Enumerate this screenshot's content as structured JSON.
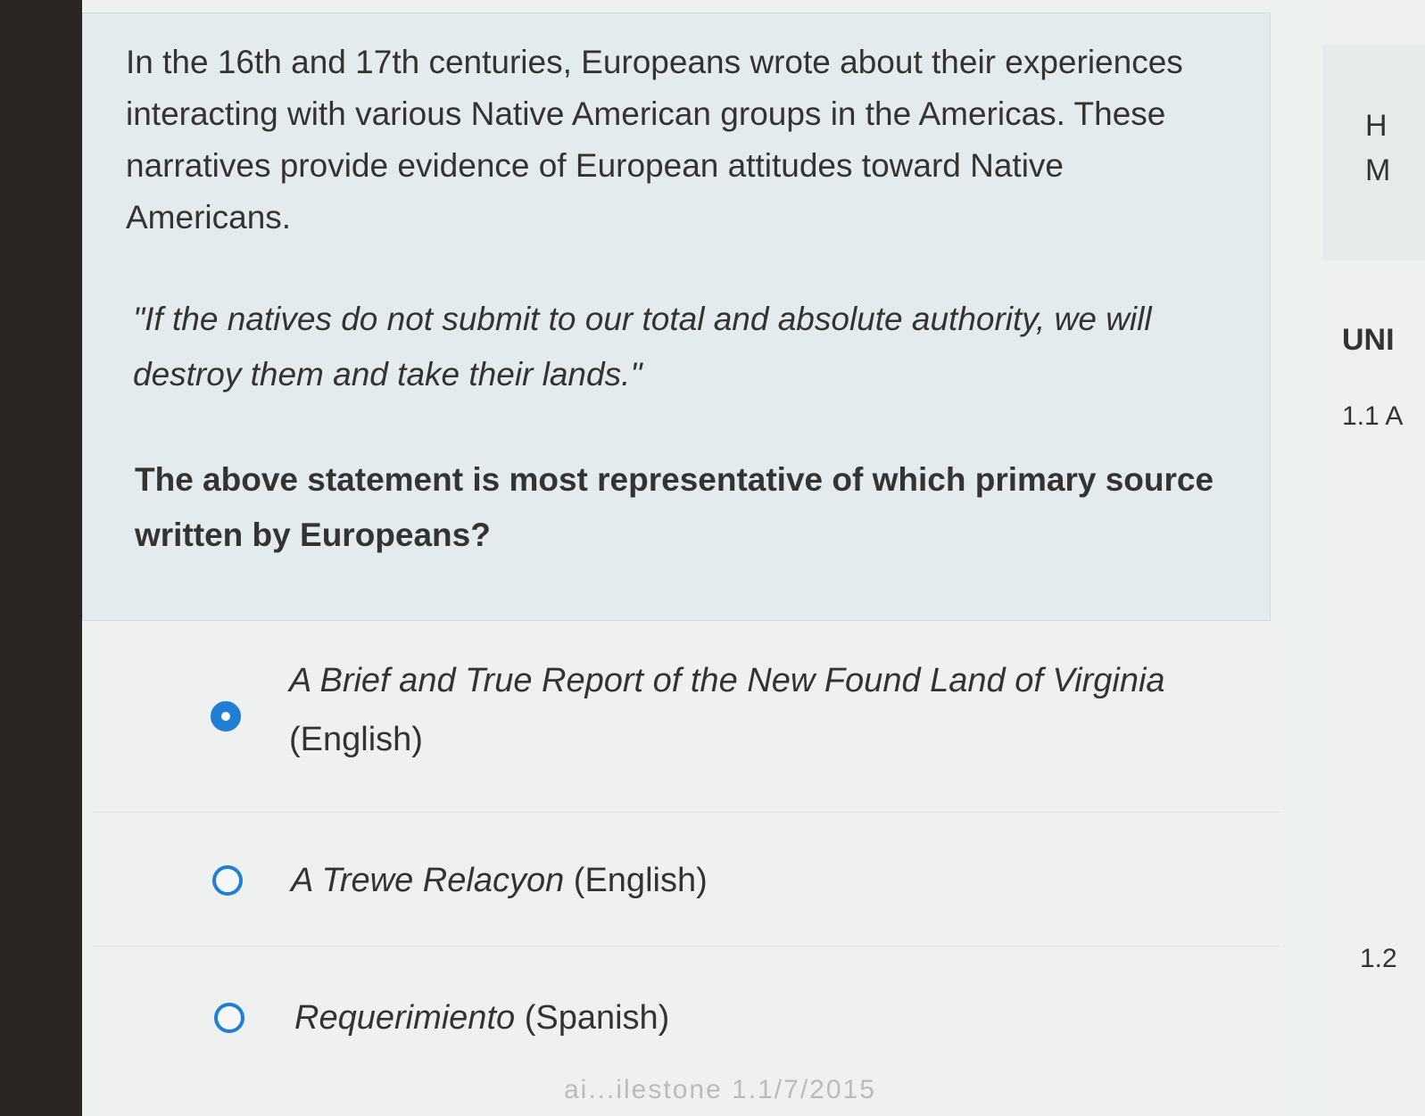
{
  "question": {
    "intro": "In the 16th and 17th centuries, Europeans wrote about their experiences interacting with various Native American groups in the Americas. These narratives provide evidence of European attitudes toward Native Americans.",
    "quote": "\"If the natives do not submit to our total and absolute authority, we will destroy them and take their lands.\"",
    "prompt": "The above statement is most representative of which primary source written by Europeans?"
  },
  "answers": [
    {
      "title": "A Brief and True Report of the New Found Land of Virginia",
      "language": "(English)",
      "selected": true
    },
    {
      "title": "A Trewe Relacyon",
      "language": "(English)",
      "selected": false
    },
    {
      "title": "Requerimiento",
      "language": "(Spanish)",
      "selected": false
    }
  ],
  "sidebar": {
    "card_line1": "H",
    "card_line2": "M",
    "unit_label": "UNI",
    "lesson_1": "1.1 A",
    "lesson_2": "1.2"
  },
  "footer_fragment": "ai...ilestone 1.1/7/2015",
  "colors": {
    "accent": "#1f7fd6"
  }
}
